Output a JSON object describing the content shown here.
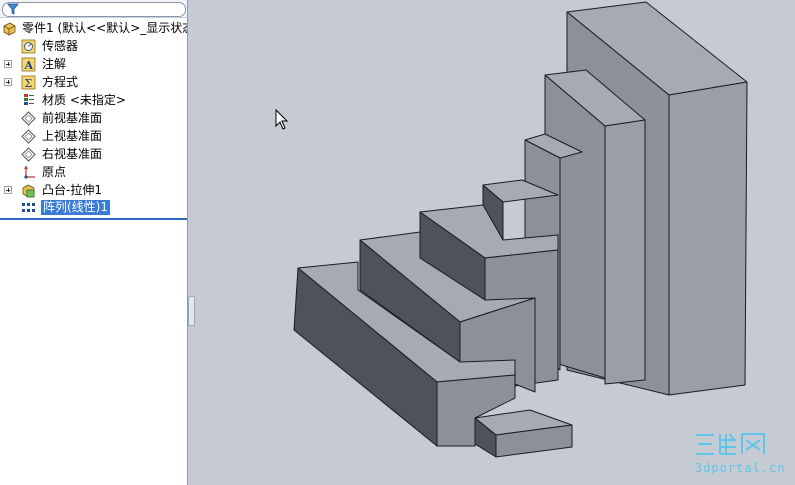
{
  "feature_tree": {
    "root_label": "零件1   (默认<<默认>_显示状态",
    "items": [
      {
        "label": "传感器",
        "icon": "sensor-icon",
        "expandable": false
      },
      {
        "label": "注解",
        "icon": "annotation-icon",
        "expandable": true
      },
      {
        "label": "方程式",
        "icon": "equation-icon",
        "expandable": true
      },
      {
        "label": "材质 <未指定>",
        "icon": "material-icon",
        "expandable": false
      },
      {
        "label": "前视基准面",
        "icon": "plane-icon",
        "expandable": false
      },
      {
        "label": "上视基准面",
        "icon": "plane-icon",
        "expandable": false
      },
      {
        "label": "右视基准面",
        "icon": "plane-icon",
        "expandable": false
      },
      {
        "label": "原点",
        "icon": "origin-icon",
        "expandable": false
      },
      {
        "label": "凸台-拉伸1",
        "icon": "extrude-icon",
        "expandable": true
      },
      {
        "label": "阵列(线性)1",
        "icon": "linear-pattern-icon",
        "expandable": false,
        "selected": true
      }
    ]
  },
  "watermark": {
    "logo_text": "三维网",
    "url_text": "3dportal.cn"
  },
  "colors": {
    "viewport_bg": "#c6cad3",
    "selection": "#3a7bd5",
    "face_top": "#a7a9b3",
    "face_front": "#4f515d",
    "face_right": "#8e9099",
    "watermark": "#5ec6e8"
  }
}
